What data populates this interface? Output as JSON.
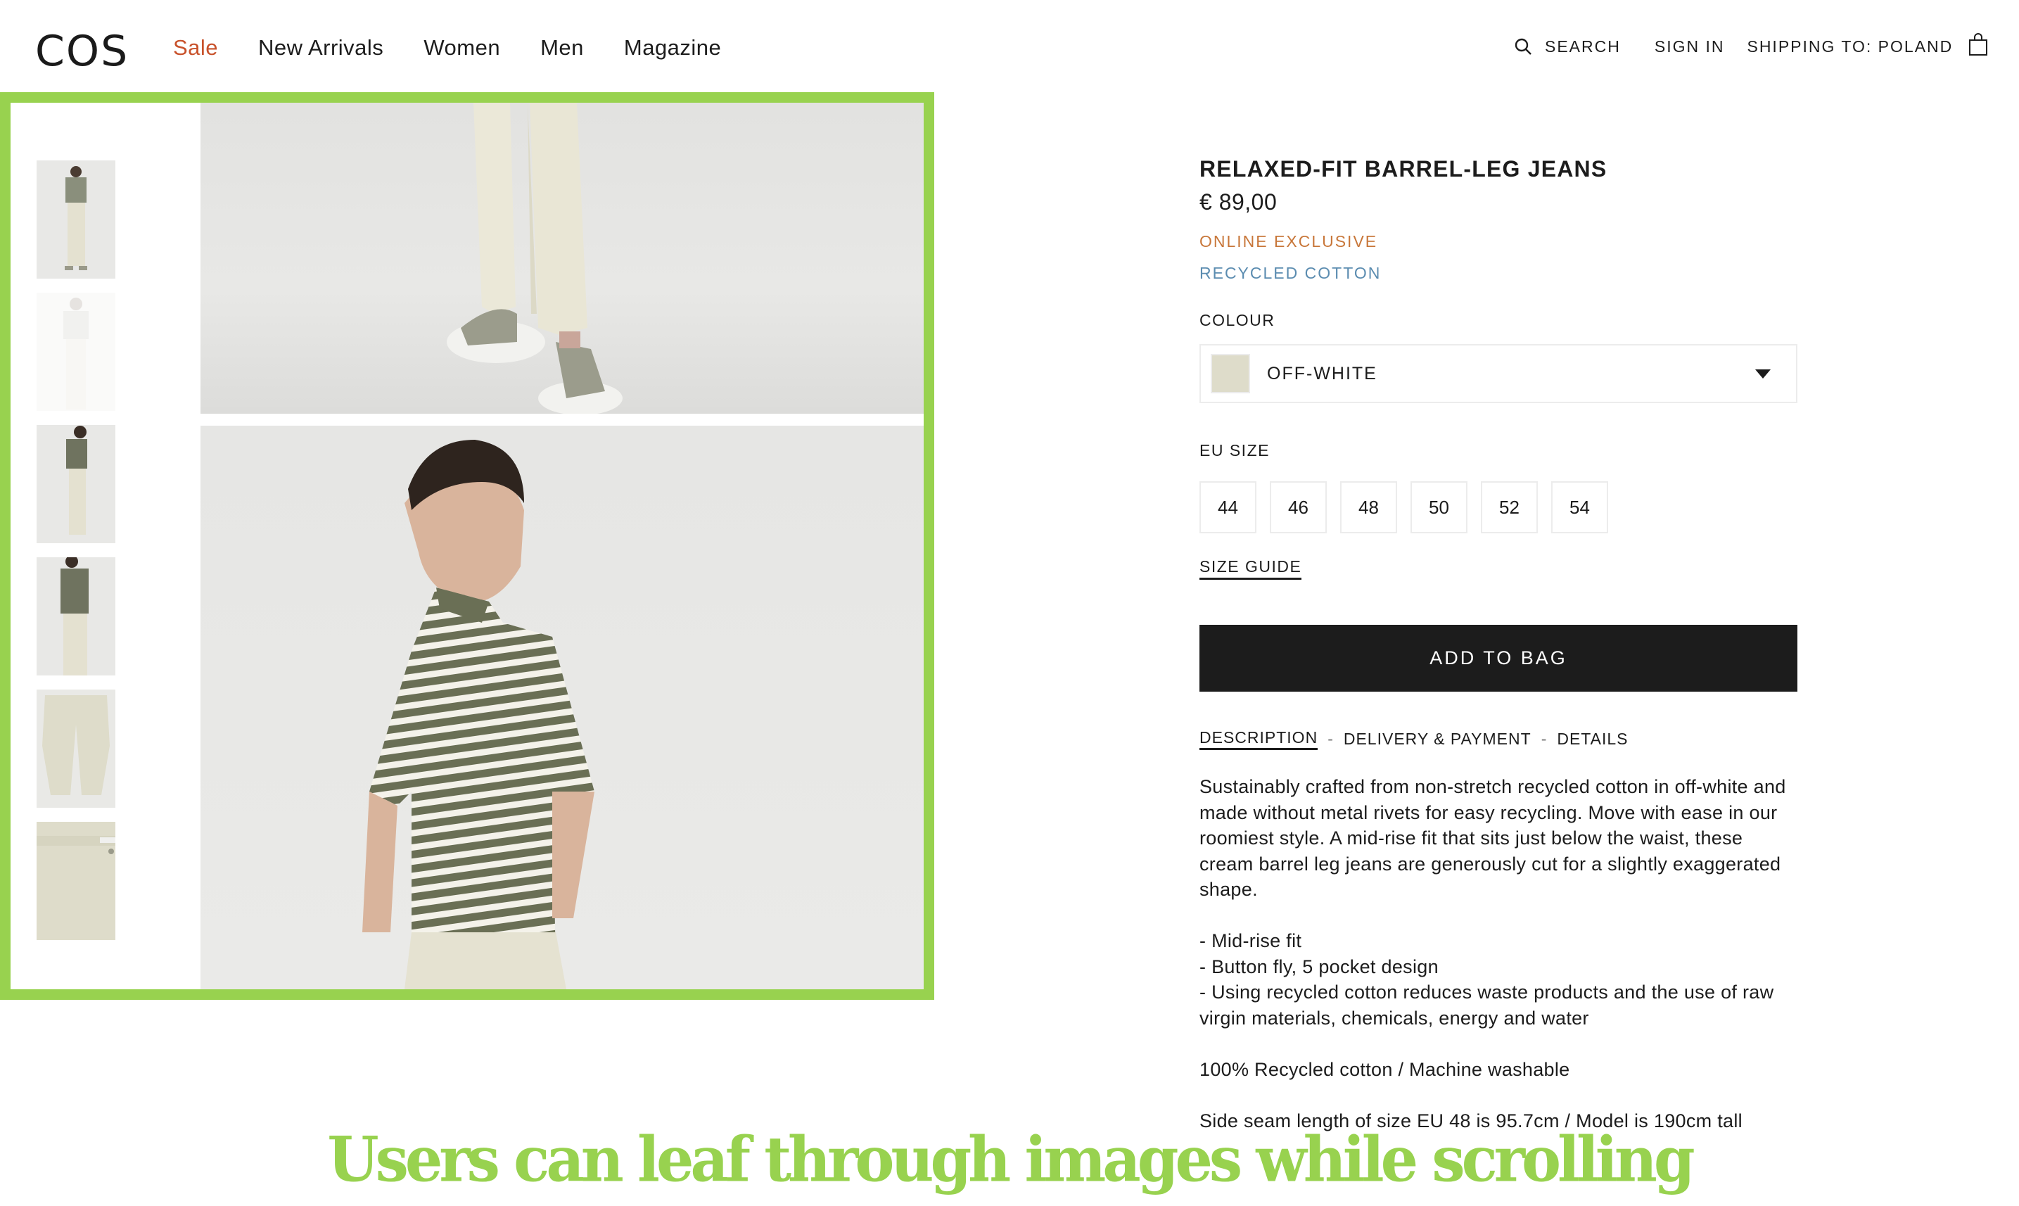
{
  "header": {
    "logo": "COS",
    "nav": [
      {
        "label": "Sale",
        "highlight": true
      },
      {
        "label": "New Arrivals"
      },
      {
        "label": "Women"
      },
      {
        "label": "Men"
      },
      {
        "label": "Magazine"
      }
    ],
    "utility": {
      "search_icon": "search-icon",
      "search_label": "SEARCH",
      "signin_label": "SIGN IN",
      "shipping_label": "SHIPPING TO: POLAND",
      "bag_icon": "shopping-bag-icon"
    }
  },
  "gallery": {
    "thumbnails": [
      {
        "alt": "Model full-length front view",
        "active": true
      },
      {
        "alt": "Model full-length angled view",
        "active": false
      },
      {
        "alt": "Model side view",
        "active": true
      },
      {
        "alt": "Model back/side view",
        "active": true
      },
      {
        "alt": "Jeans flat lay",
        "active": true
      },
      {
        "alt": "Jeans waistband detail",
        "active": true
      }
    ],
    "images": [
      {
        "alt": "Close-up of jeans hem and sneakers"
      },
      {
        "alt": "Model wearing striped t-shirt and off-white jeans"
      }
    ]
  },
  "product": {
    "title": "RELAXED-FIT BARREL-LEG JEANS",
    "price": "€ 89,00",
    "badges": {
      "online_exclusive": "ONLINE EXCLUSIVE",
      "recycled": "RECYCLED COTTON"
    },
    "colour": {
      "label": "COLOUR",
      "value": "OFF-WHITE",
      "swatch_color": "#dedcca"
    },
    "size": {
      "label": "EU SIZE",
      "options": [
        "44",
        "46",
        "48",
        "50",
        "52",
        "54"
      ],
      "guide_label": "SIZE GUIDE"
    },
    "add_to_bag_label": "ADD TO BAG",
    "tabs": [
      {
        "label": "DESCRIPTION",
        "active": true
      },
      {
        "label": "DELIVERY & PAYMENT",
        "active": false
      },
      {
        "label": "DETAILS",
        "active": false
      }
    ],
    "tab_separator": "-",
    "description": {
      "intro": "Sustainably crafted from non-stretch recycled cotton in off-white and made without metal rivets for easy recycling. Move with ease in our roomiest style. A mid-rise fit that sits just below the waist, these cream barrel leg jeans are generously cut for a slightly exaggerated shape.",
      "bullets": [
        "- Mid-rise fit",
        "- Button fly, 5 pocket design",
        "- Using recycled cotton reduces waste products and the use of raw virgin materials, chemicals, energy and water"
      ],
      "composition": "100% Recycled cotton / Machine washable",
      "fit": "Side seam length of size EU 48 is 95.7cm / Model is 190cm tall"
    }
  },
  "annotation": {
    "caption": "Users can leaf through images while scrolling",
    "highlight_color": "#98d24f"
  },
  "colors": {
    "sale": "#c8512a",
    "online_exclusive": "#c8773a",
    "recycled": "#5b8cb0",
    "button_bg": "#1c1c1c"
  }
}
